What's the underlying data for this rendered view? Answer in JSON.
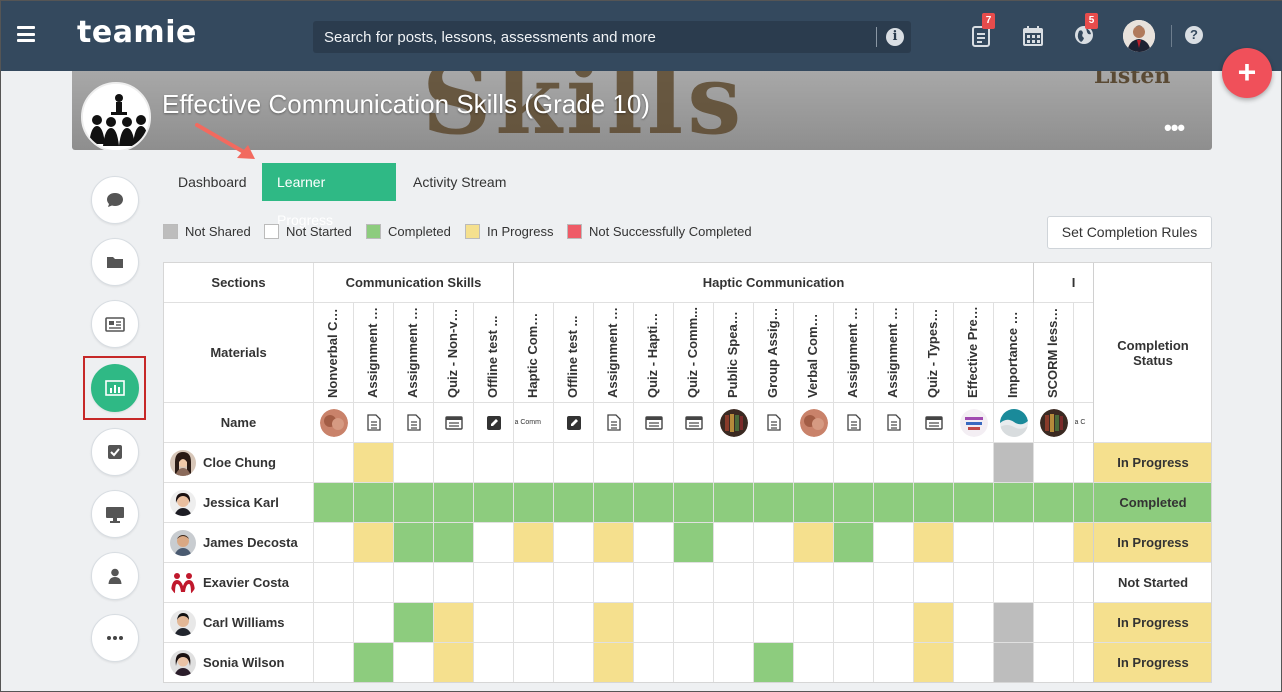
{
  "app": {
    "logo_text": "teamie",
    "search_placeholder": "Search for posts, lessons, assessments and more",
    "notif_posts_count": "7",
    "notif_global_count": "5"
  },
  "course": {
    "title": "Effective Communication Skills (Grade 10)",
    "banner_word": "Skills",
    "banner_word2": "Listen",
    "more": "•••"
  },
  "tabs": [
    {
      "label": "Dashboard",
      "active": false
    },
    {
      "label": "Learner Progress",
      "active": true
    },
    {
      "label": "Activity Stream",
      "active": false
    }
  ],
  "legend": [
    {
      "label": "Not Shared",
      "color": "#bdbdbd"
    },
    {
      "label": "Not Started",
      "color": "#ffffff"
    },
    {
      "label": "Completed",
      "color": "#8dcc7e"
    },
    {
      "label": "In Progress",
      "color": "#f5e08e"
    },
    {
      "label": "Not Successfully Completed",
      "color": "#ef5b67"
    }
  ],
  "set_rules_label": "Set Completion Rules",
  "grid": {
    "sections_label": "Sections",
    "materials_label": "Materials",
    "name_label": "Name",
    "completion_label": "Completion Status",
    "sections": [
      {
        "name": "Communication Skills",
        "span": 5
      },
      {
        "name": "Haptic Communication",
        "span": 13
      },
      {
        "name": "I",
        "span": 2
      }
    ],
    "materials": [
      {
        "name": "Nonverbal Co...",
        "icon": "image-thumb"
      },
      {
        "name": "Assignment - ...",
        "icon": "document-icon"
      },
      {
        "name": "Assignment - ...",
        "icon": "document-icon"
      },
      {
        "name": "Quiz - Non-ve...",
        "icon": "quiz-icon"
      },
      {
        "name": "Offline test ...",
        "icon": "pencil-icon"
      },
      {
        "name": "Haptic Comm...",
        "icon": "text-thumb"
      },
      {
        "name": "Offline test ...",
        "icon": "pencil-icon"
      },
      {
        "name": "Assignment - ...",
        "icon": "document-icon"
      },
      {
        "name": "Quiz - Haptic ...",
        "icon": "quiz-icon"
      },
      {
        "name": "Quiz - Comm...",
        "icon": "quiz-icon"
      },
      {
        "name": "Public Speaki...",
        "icon": "books-thumb"
      },
      {
        "name": "Group Assign...",
        "icon": "document-icon"
      },
      {
        "name": "Verbal Comm...",
        "icon": "image-thumb"
      },
      {
        "name": "Assignment - ...",
        "icon": "document-icon"
      },
      {
        "name": "Assignment - ...",
        "icon": "document-icon"
      },
      {
        "name": "Quiz - Types o...",
        "icon": "quiz-icon"
      },
      {
        "name": "Effective Pres...",
        "icon": "wordcloud-thumb"
      },
      {
        "name": "Importance o...",
        "icon": "wave-thumb"
      },
      {
        "name": "SCORM lesson",
        "icon": "books-thumb"
      },
      {
        "name": "",
        "icon": "text-thumb"
      }
    ],
    "thumb_text": "a Comm",
    "thumb_text2": "a C",
    "students": [
      {
        "name": "Cloe Chung",
        "status": "In Progress",
        "cells": [
          "N",
          "P",
          "N",
          "N",
          "N",
          "N",
          "N",
          "N",
          "N",
          "N",
          "N",
          "N",
          "N",
          "N",
          "N",
          "N",
          "N",
          "S",
          "N",
          "N"
        ]
      },
      {
        "name": "Jessica Karl",
        "status": "Completed",
        "cells": [
          "C",
          "C",
          "C",
          "C",
          "C",
          "C",
          "C",
          "C",
          "C",
          "C",
          "C",
          "C",
          "C",
          "C",
          "C",
          "C",
          "C",
          "C",
          "C",
          "C"
        ]
      },
      {
        "name": "James Decosta",
        "status": "In Progress",
        "cells": [
          "N",
          "P",
          "C",
          "C",
          "N",
          "P",
          "N",
          "P",
          "N",
          "C",
          "N",
          "N",
          "P",
          "C",
          "N",
          "P",
          "N",
          "N",
          "N",
          "P"
        ]
      },
      {
        "name": "Exavier Costa",
        "status": "Not Started",
        "cells": [
          "N",
          "N",
          "N",
          "N",
          "N",
          "N",
          "N",
          "N",
          "N",
          "N",
          "N",
          "N",
          "N",
          "N",
          "N",
          "N",
          "N",
          "N",
          "N",
          "N"
        ]
      },
      {
        "name": "Carl Williams",
        "status": "In Progress",
        "cells": [
          "N",
          "N",
          "C",
          "P",
          "N",
          "N",
          "N",
          "P",
          "N",
          "N",
          "N",
          "N",
          "N",
          "N",
          "N",
          "P",
          "N",
          "S",
          "N",
          "N"
        ]
      },
      {
        "name": "Sonia Wilson",
        "status": "In Progress",
        "cells": [
          "N",
          "C",
          "N",
          "P",
          "N",
          "N",
          "N",
          "P",
          "N",
          "N",
          "N",
          "C",
          "N",
          "N",
          "N",
          "P",
          "N",
          "S",
          "N",
          "N"
        ]
      }
    ],
    "status_colors": {
      "In Progress": "#f5e08e",
      "Completed": "#8dcc7e",
      "Not Started": "#ffffff"
    }
  }
}
